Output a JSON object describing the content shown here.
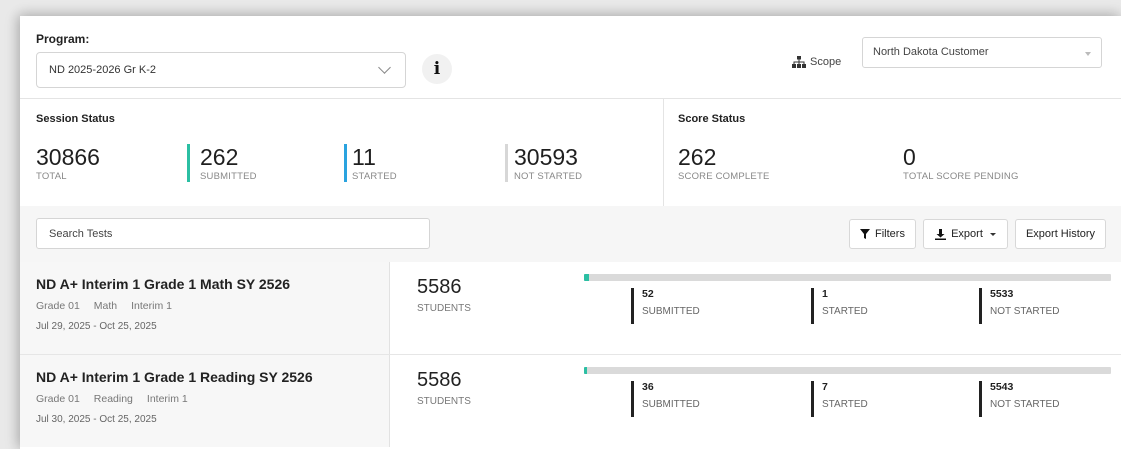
{
  "header": {
    "program_label": "Program:",
    "program_value": "ND 2025-2026 Gr K-2",
    "info_glyph": "i",
    "scope_label": "Scope",
    "scope_value": "North Dakota Customer"
  },
  "session_status": {
    "title": "Session Status",
    "total": {
      "value": "30866",
      "label": "TOTAL"
    },
    "submitted": {
      "value": "262",
      "label": "SUBMITTED"
    },
    "started": {
      "value": "11",
      "label": "STARTED"
    },
    "not_started": {
      "value": "30593",
      "label": "NOT STARTED"
    }
  },
  "score_status": {
    "title": "Score Status",
    "complete": {
      "value": "262",
      "label": "SCORE COMPLETE"
    },
    "pending": {
      "value": "0",
      "label": "TOTAL SCORE PENDING"
    }
  },
  "toolbar": {
    "search_placeholder": "Search Tests",
    "filters_label": "Filters",
    "export_label": "Export",
    "export_history_label": "Export History"
  },
  "tests": [
    {
      "title": "ND A+ Interim 1 Grade 1 Math SY 2526",
      "grade": "Grade 01",
      "subject": "Math",
      "type": "Interim 1",
      "dates": "Jul 29, 2025 - Oct 25, 2025",
      "students": "5586",
      "students_label": "STUDENTS",
      "progress_percent": 0.9,
      "submitted": "52",
      "submitted_label": "SUBMITTED",
      "started": "1",
      "started_label": "STARTED",
      "not_started": "5533",
      "not_started_label": "NOT STARTED"
    },
    {
      "title": "ND A+ Interim 1 Grade 1 Reading SY 2526",
      "grade": "Grade 01",
      "subject": "Reading",
      "type": "Interim 1",
      "dates": "Jul 30, 2025 - Oct 25, 2025",
      "students": "5586",
      "students_label": "STUDENTS",
      "progress_percent": 0.6,
      "submitted": "36",
      "submitted_label": "SUBMITTED",
      "started": "7",
      "started_label": "STARTED",
      "not_started": "5543",
      "not_started_label": "NOT STARTED"
    }
  ],
  "colors": {
    "submitted": "#2bbfa3",
    "started": "#2aa3df",
    "not_started": "#d7d7d7"
  }
}
